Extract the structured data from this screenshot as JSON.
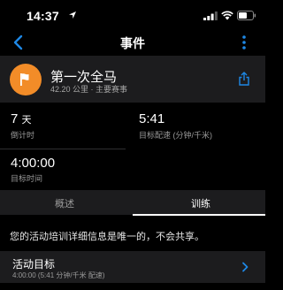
{
  "status_bar": {
    "time": "14:37"
  },
  "nav": {
    "title": "事件"
  },
  "event": {
    "name": "第一次全马",
    "subtitle": "42.20 公里 · 主要赛事"
  },
  "stats": {
    "countdown_value": "7",
    "countdown_unit": "天",
    "countdown_label": "倒计时",
    "pace_value": "5:41",
    "pace_label": "目标配速 (分钟/千米)",
    "goal_time_value": "4:00:00",
    "goal_time_label": "目标时间"
  },
  "tabs": [
    {
      "label": "概述",
      "active": false
    },
    {
      "label": "训练",
      "active": true
    }
  ],
  "info_text": "您的活动培训详细信息是唯一的，不会共享。",
  "goal_row": {
    "title": "活动目标",
    "subtitle": "4:00:00 (5:41 分钟/千米 配速)"
  },
  "colors": {
    "accent": "#1e88e5",
    "flag_circle": "#f28c28",
    "surface": "#1c1c1e",
    "background": "#000000"
  }
}
